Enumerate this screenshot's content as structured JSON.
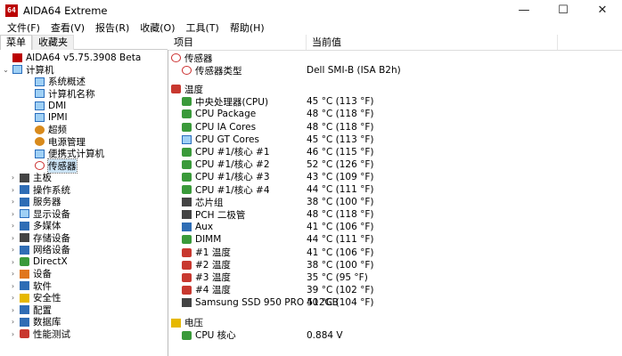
{
  "window": {
    "icon_text": "64",
    "title": "AIDA64 Extreme",
    "minimize": "—",
    "maximize": "☐",
    "close": "✕"
  },
  "menu": [
    "文件(F)",
    "查看(V)",
    "报告(R)",
    "收藏(O)",
    "工具(T)",
    "帮助(H)"
  ],
  "left_tabs": [
    "菜单",
    "收藏夹"
  ],
  "tree": {
    "root": "AIDA64 v5.75.3908 Beta",
    "computer": "计算机",
    "computer_children": [
      "系统概述",
      "计算机名称",
      "DMI",
      "IPMI",
      "超频",
      "电源管理",
      "便携式计算机",
      "传感器"
    ],
    "others": [
      "主板",
      "操作系统",
      "服务器",
      "显示设备",
      "多媒体",
      "存储设备",
      "网络设备",
      "DirectX",
      "设备",
      "软件",
      "安全性",
      "配置",
      "数据库",
      "性能测试"
    ]
  },
  "columns": {
    "item": "项目",
    "value": "当前值"
  },
  "sections": {
    "sensor": {
      "title": "传感器",
      "rows": [
        {
          "label": "传感器类型",
          "value": "Dell SMI-B  (ISA B2h)"
        }
      ]
    },
    "temperature": {
      "title": "温度",
      "rows": [
        {
          "label": "中央处理器(CPU)",
          "value": "45 °C  (113 °F)"
        },
        {
          "label": "CPU Package",
          "value": "48 °C  (118 °F)"
        },
        {
          "label": "CPU IA Cores",
          "value": "48 °C  (118 °F)"
        },
        {
          "label": "CPU GT Cores",
          "value": "45 °C  (113 °F)"
        },
        {
          "label": "CPU #1/核心 #1",
          "value": "46 °C  (115 °F)"
        },
        {
          "label": "CPU #1/核心 #2",
          "value": "52 °C  (126 °F)"
        },
        {
          "label": "CPU #1/核心 #3",
          "value": "43 °C  (109 °F)"
        },
        {
          "label": "CPU #1/核心 #4",
          "value": "44 °C  (111 °F)"
        },
        {
          "label": "芯片组",
          "value": "38 °C  (100 °F)"
        },
        {
          "label": "PCH 二极管",
          "value": "48 °C  (118 °F)"
        },
        {
          "label": "Aux",
          "value": "41 °C  (106 °F)"
        },
        {
          "label": "DIMM",
          "value": "44 °C  (111 °F)"
        },
        {
          "label": "#1 温度",
          "value": "41 °C  (106 °F)"
        },
        {
          "label": "#2 温度",
          "value": "38 °C  (100 °F)"
        },
        {
          "label": "#3 温度",
          "value": "35 °C  (95 °F)"
        },
        {
          "label": "#4 温度",
          "value": "39 °C  (102 °F)"
        },
        {
          "label": "Samsung SSD 950 PRO 512GB",
          "value": "40 °C  (104 °F)"
        }
      ]
    },
    "voltage": {
      "title": "电压",
      "rows": [
        {
          "label": "CPU 核心",
          "value": "0.884 V"
        }
      ]
    }
  }
}
